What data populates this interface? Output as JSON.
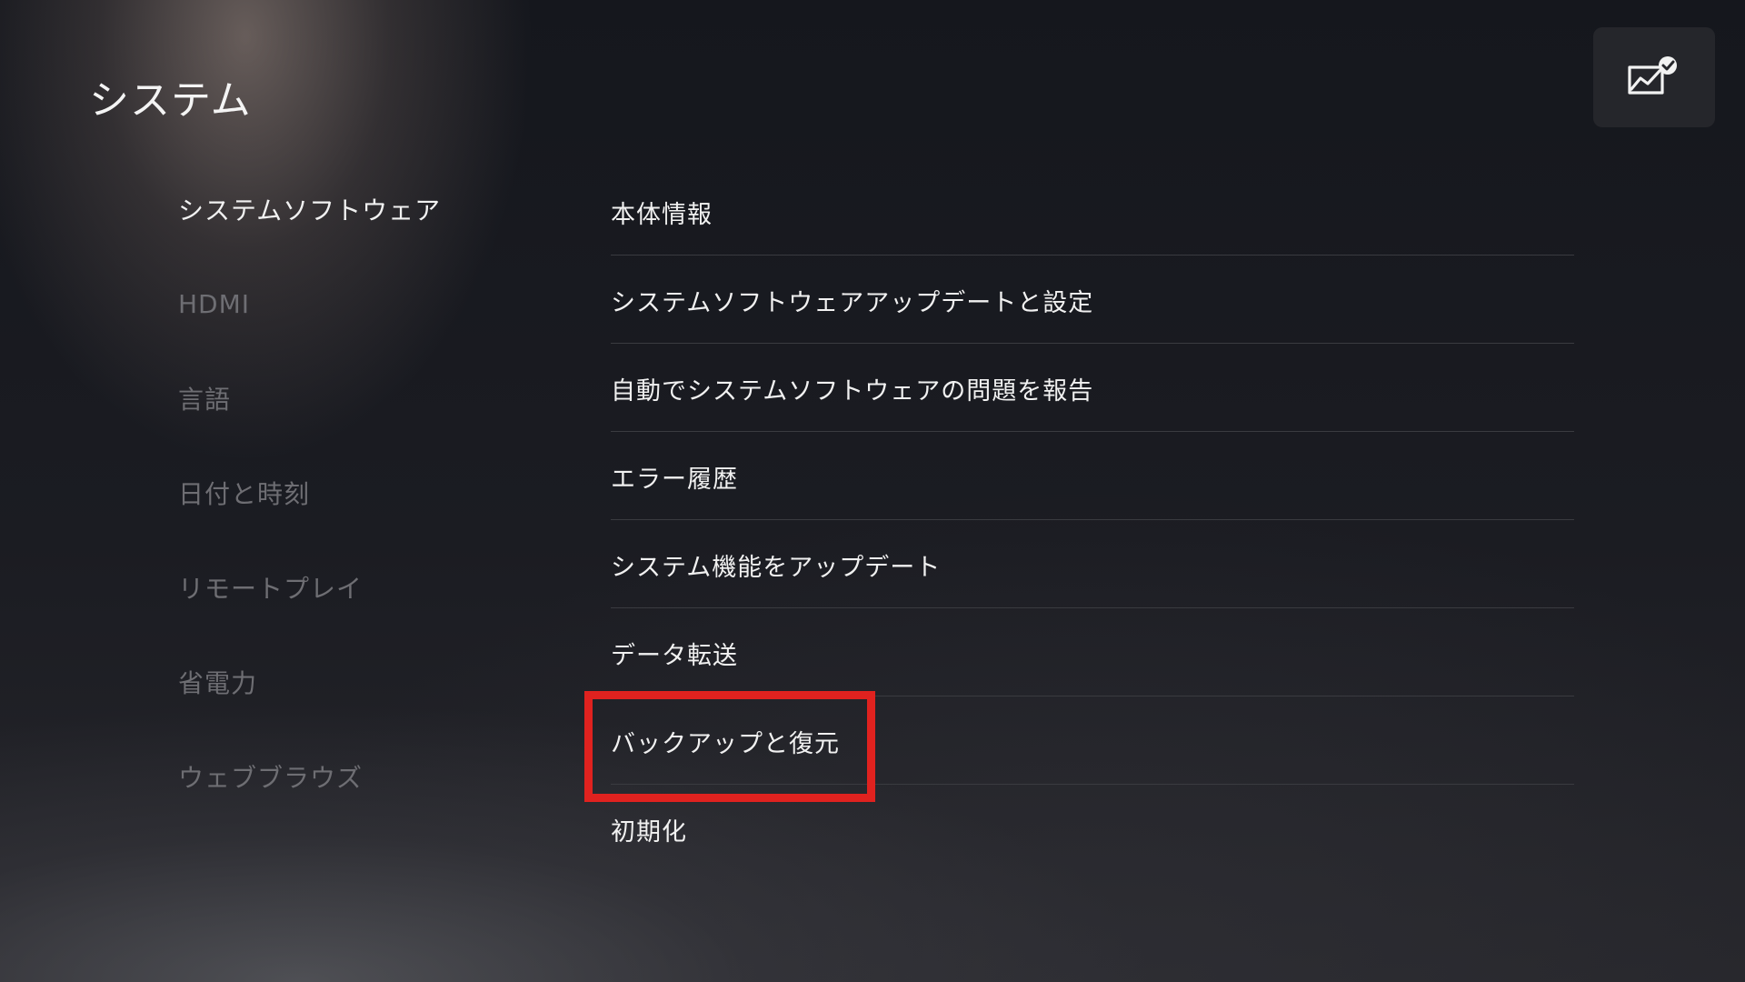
{
  "page": {
    "title": "システム"
  },
  "status_tile": {
    "icon": "performance-check-icon"
  },
  "side_menu": {
    "items": [
      {
        "label": "システムソフトウェア",
        "active": true
      },
      {
        "label": "HDMI",
        "active": false
      },
      {
        "label": "言語",
        "active": false
      },
      {
        "label": "日付と時刻",
        "active": false
      },
      {
        "label": "リモートプレイ",
        "active": false
      },
      {
        "label": "省電力",
        "active": false
      },
      {
        "label": "ウェブブラウズ",
        "active": false
      }
    ]
  },
  "content": {
    "items": [
      {
        "label": "本体情報"
      },
      {
        "label": "システムソフトウェアアップデートと設定"
      },
      {
        "label": "自動でシステムソフトウェアの問題を報告"
      },
      {
        "label": "エラー履歴"
      },
      {
        "label": "システム機能をアップデート"
      },
      {
        "label": "データ転送"
      },
      {
        "label": "バックアップと復元",
        "highlighted": true
      },
      {
        "label": "初期化"
      }
    ]
  },
  "colors": {
    "highlight": "#e0221f",
    "active_text": "#f1f1f1",
    "inactive_text": "#6e6e73",
    "divider": "#3a3b40"
  }
}
